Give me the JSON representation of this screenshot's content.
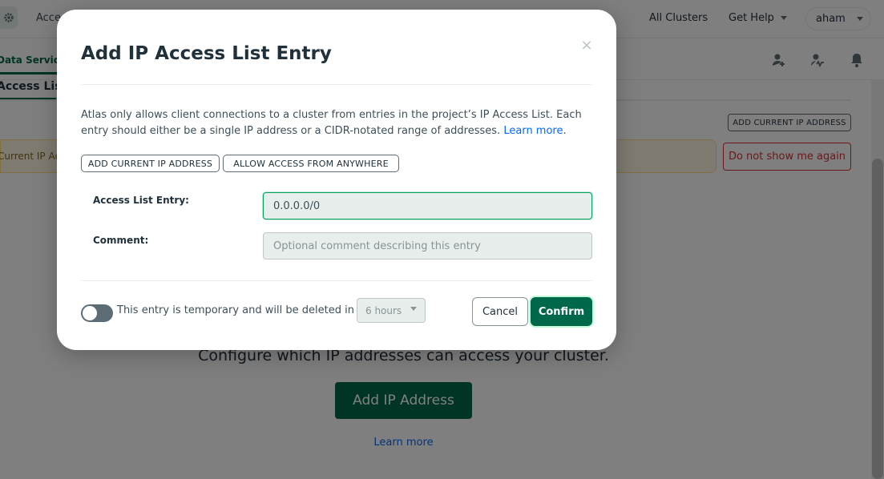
{
  "topbar": {
    "access_label": "Acce",
    "all_clusters": "All Clusters",
    "get_help": "Get Help",
    "user": "aham"
  },
  "secondary_nav": {
    "data_services": "Data Services"
  },
  "page": {
    "active_tab": "Access List",
    "add_current_ip": "ADD CURRENT IP ADDRESS",
    "banner_text": "Current IP Ac",
    "do_not_show": "Do not show me again",
    "empty_state_title": "Configure which IP addresses can access your cluster.",
    "add_ip_button": "Add IP Address",
    "learn_more": "Learn more"
  },
  "modal": {
    "title": "Add IP Access List Entry",
    "close_symbol": "×",
    "description": "Atlas only allows client connections to a cluster from entries in the project’s IP Access List. Each entry should either be a single IP address or a CIDR-notated range of addresses.",
    "learn_more": "Learn more",
    "add_current_ip": "ADD CURRENT IP ADDRESS",
    "allow_anywhere": "ALLOW ACCESS FROM ANYWHERE",
    "entry_label": "Access List Entry:",
    "entry_value": "0.0.0.0/0",
    "comment_label": "Comment:",
    "comment_placeholder": "Optional comment describing this entry",
    "temporary_label": "This entry is temporary and will be deleted in",
    "temporary_enabled": false,
    "duration_value": "6 hours",
    "cancel": "Cancel",
    "confirm": "Confirm"
  },
  "colors": {
    "brand_green": "#00684a",
    "link_blue": "#016bf8",
    "danger_red": "#db3030"
  }
}
